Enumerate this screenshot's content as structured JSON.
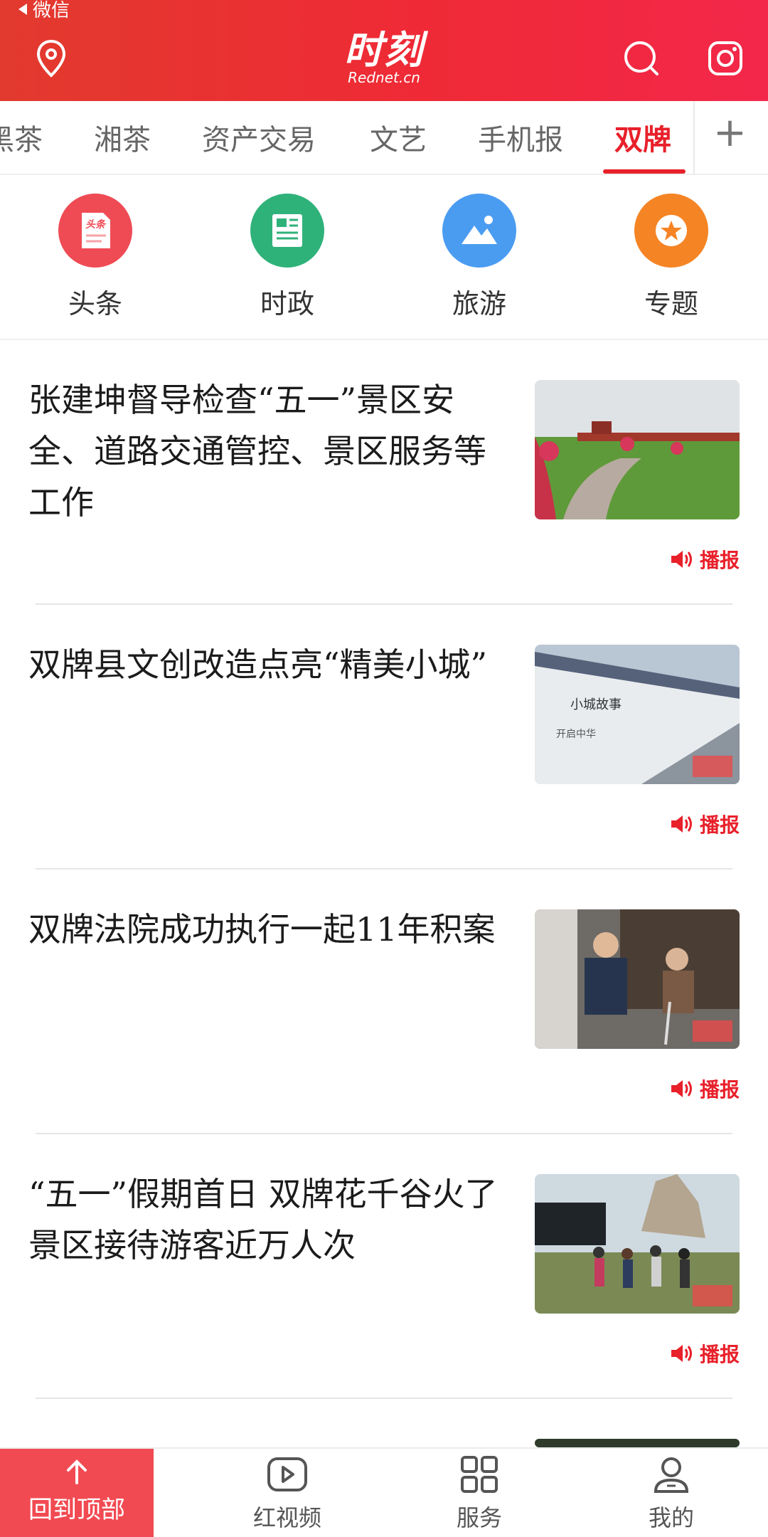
{
  "status": {
    "back_label": "微信"
  },
  "header": {
    "logo_cn": "时刻",
    "logo_en": "Rednet.cn"
  },
  "tabs": {
    "items": [
      "黑茶",
      "湘茶",
      "资产交易",
      "文艺",
      "手机报",
      "双牌"
    ],
    "active": "双牌",
    "add_label": "+"
  },
  "quick_links": [
    {
      "label": "头条",
      "icon": "headline-icon",
      "color": "#ef4b55"
    },
    {
      "label": "时政",
      "icon": "politics-news-icon",
      "color": "#2fb27a"
    },
    {
      "label": "旅游",
      "icon": "travel-landscape-icon",
      "color": "#4a9cf1"
    },
    {
      "label": "专题",
      "icon": "special-topic-star-icon",
      "color": "#f58424"
    }
  ],
  "headline_icon_text": "头条",
  "news": [
    {
      "title": "张建坤督导检查“五一”景区安全、道路交通管控、景区服务等工作",
      "broadcast": "播报"
    },
    {
      "title": "双牌县文创改造点亮“精美小城”",
      "broadcast": "播报"
    },
    {
      "title": "双牌法院成功执行一起11年积案",
      "broadcast": "播报"
    },
    {
      "title": "“五一”假期首日 双牌花千谷火了 景区接待游客近万人次",
      "broadcast": "播报"
    }
  ],
  "bottom_nav": {
    "back_to_top": "回到顶部",
    "items": [
      {
        "label": "红视频",
        "icon": "video-play-icon"
      },
      {
        "label": "服务",
        "icon": "grid-service-icon"
      },
      {
        "label": "我的",
        "icon": "profile-icon"
      }
    ]
  },
  "colors": {
    "brand_red": "#e8202a",
    "header_red": "#ef2a36"
  }
}
